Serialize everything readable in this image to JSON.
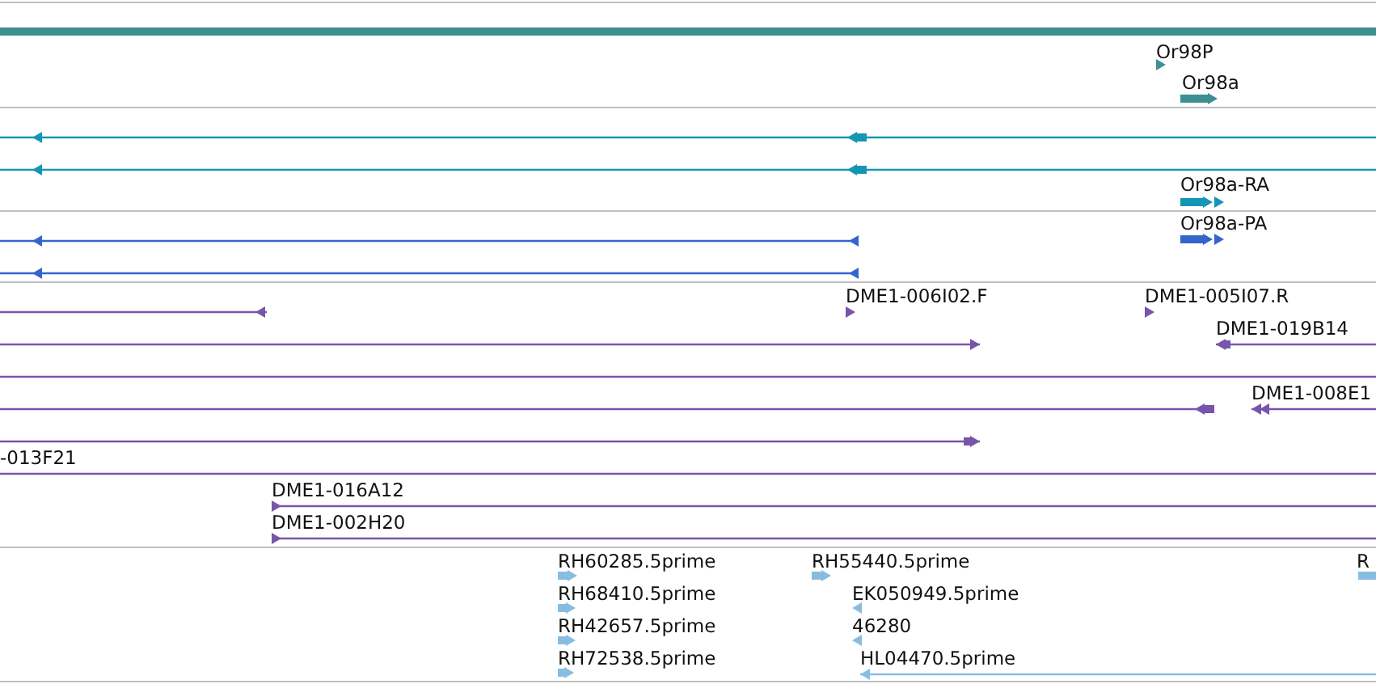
{
  "tracks": [
    {
      "kind": "genes",
      "features": [
        {
          "kind": "span"
        },
        {
          "kind": "arrow",
          "label": "Or98P",
          "reverse": false
        },
        {
          "kind": "arrow",
          "label": "Or98a",
          "reverse": false
        }
      ]
    },
    {
      "kind": "transcripts",
      "features": [
        {
          "kind": "arrow",
          "reverse": true
        },
        {
          "kind": "arrow",
          "reverse": true
        },
        {
          "kind": "arrow",
          "label": "Or98a-RA",
          "reverse": false
        }
      ]
    },
    {
      "kind": "proteins",
      "features": [
        {
          "kind": "arrow",
          "reverse": true
        },
        {
          "kind": "arrow",
          "reverse": true
        },
        {
          "kind": "arrow",
          "label": "Or98a-PA",
          "reverse": false
        }
      ]
    },
    {
      "kind": "bac_ends",
      "features": [
        {
          "kind": "arrow",
          "reverse": true
        },
        {
          "kind": "arrow",
          "label": "DME1-006I02.F",
          "reverse": false
        },
        {
          "kind": "arrow",
          "label": "DME1-005I07.R",
          "reverse": false
        },
        {
          "kind": "arrow",
          "reverse": false
        },
        {
          "kind": "arrow",
          "label": "DME1-019B14",
          "reverse": true
        },
        {
          "kind": "span"
        },
        {
          "kind": "arrow",
          "reverse": true
        },
        {
          "kind": "arrow",
          "label": "DME1-008E1",
          "reverse": true
        },
        {
          "kind": "arrow",
          "reverse": false
        },
        {
          "kind": "span",
          "label": "-013F21"
        },
        {
          "kind": "arrow",
          "label": "DME1-016A12",
          "reverse": false
        },
        {
          "kind": "arrow",
          "label": "DME1-002H20",
          "reverse": false
        }
      ]
    },
    {
      "kind": "ests",
      "features": [
        {
          "kind": "arrow",
          "label": "RH60285.5prime",
          "reverse": false
        },
        {
          "kind": "arrow",
          "label": "RH68410.5prime",
          "reverse": false
        },
        {
          "kind": "arrow",
          "label": "RH42657.5prime",
          "reverse": false
        },
        {
          "kind": "arrow",
          "label": "RH72538.5prime",
          "reverse": false
        },
        {
          "kind": "arrow",
          "label": "RH55440.5prime",
          "reverse": false
        },
        {
          "kind": "arrow",
          "label": "EK050949.5prime",
          "reverse": true
        },
        {
          "kind": "arrow",
          "label": "46280",
          "reverse": true
        },
        {
          "kind": "arrow",
          "label": "HL04470.5prime",
          "reverse": true
        },
        {
          "kind": "span",
          "label": "R"
        }
      ]
    }
  ]
}
